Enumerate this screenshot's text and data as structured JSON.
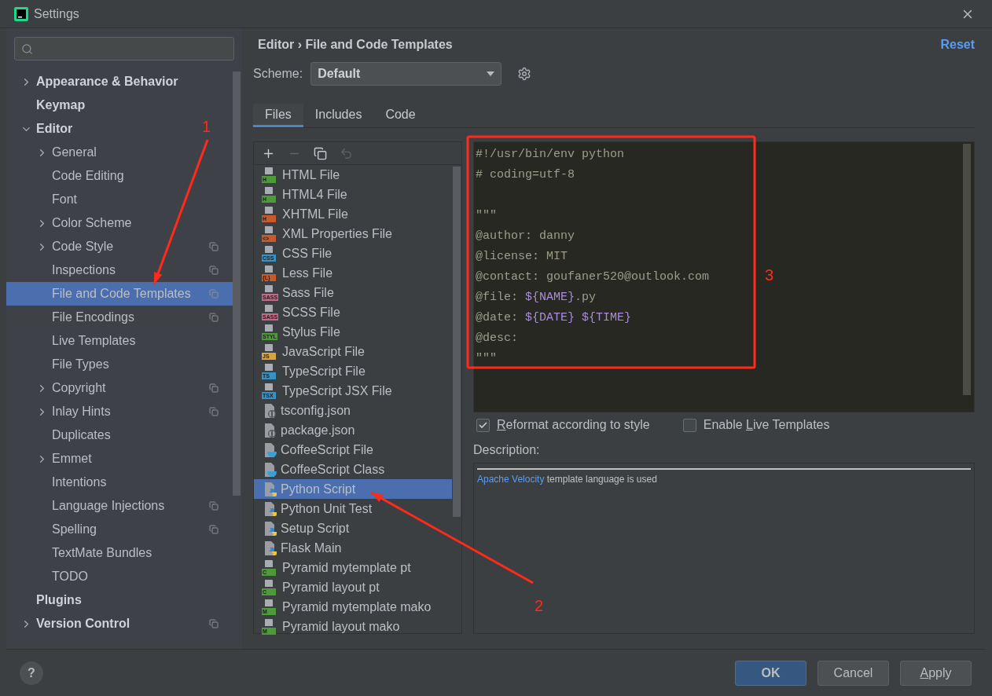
{
  "window": {
    "title": "Settings"
  },
  "tree": [
    {
      "label": "Appearance & Behavior",
      "expanded": false,
      "scoped": false,
      "selected": false
    },
    {
      "label": "Keymap",
      "scoped": false,
      "selected": false
    },
    {
      "label": "Editor",
      "expanded": true,
      "scoped": false,
      "selected": false,
      "children": [
        {
          "label": "General",
          "expanded": false,
          "scoped": false,
          "selected": false
        },
        {
          "label": "Code Editing",
          "scoped": false,
          "selected": false
        },
        {
          "label": "Font",
          "scoped": false,
          "selected": false
        },
        {
          "label": "Color Scheme",
          "expanded": false,
          "scoped": false,
          "selected": false
        },
        {
          "label": "Code Style",
          "expanded": false,
          "scoped": true,
          "selected": false
        },
        {
          "label": "Inspections",
          "scoped": true,
          "selected": false
        },
        {
          "label": "File and Code Templates",
          "scoped": true,
          "selected": true
        },
        {
          "label": "File Encodings",
          "scoped": true,
          "selected": false
        },
        {
          "label": "Live Templates",
          "scoped": false,
          "selected": false
        },
        {
          "label": "File Types",
          "scoped": false,
          "selected": false
        },
        {
          "label": "Copyright",
          "expanded": false,
          "scoped": true,
          "selected": false
        },
        {
          "label": "Inlay Hints",
          "expanded": false,
          "scoped": true,
          "selected": false
        },
        {
          "label": "Duplicates",
          "scoped": false,
          "selected": false
        },
        {
          "label": "Emmet",
          "expanded": false,
          "scoped": false,
          "selected": false
        },
        {
          "label": "Intentions",
          "scoped": false,
          "selected": false
        },
        {
          "label": "Language Injections",
          "scoped": true,
          "selected": false
        },
        {
          "label": "Spelling",
          "scoped": true,
          "selected": false
        },
        {
          "label": "TextMate Bundles",
          "scoped": false,
          "selected": false
        },
        {
          "label": "TODO",
          "scoped": false,
          "selected": false
        }
      ]
    },
    {
      "label": "Plugins",
      "scoped": false,
      "selected": false
    },
    {
      "label": "Version Control",
      "expanded": false,
      "scoped": true,
      "selected": false
    }
  ],
  "breadcrumb": [
    "Editor",
    "›",
    "File and Code Templates"
  ],
  "reset": "Reset",
  "scheme": {
    "label": "Scheme:",
    "value": "Default"
  },
  "tabs": [
    {
      "label": "Files",
      "selected": true
    },
    {
      "label": "Includes",
      "selected": false
    },
    {
      "label": "Code",
      "selected": false
    }
  ],
  "toolbar": [
    {
      "kind": "add",
      "disabled": false
    },
    {
      "kind": "remove",
      "disabled": true
    },
    {
      "kind": "copy",
      "disabled": false
    },
    {
      "kind": "reset",
      "disabled": true
    }
  ],
  "templates": [
    {
      "label": "HTML File",
      "kind": "badge",
      "badge": "H",
      "color": "#4e9a3a",
      "selected": false
    },
    {
      "label": "HTML4 File",
      "kind": "badge",
      "badge": "H",
      "color": "#4e9a3a",
      "selected": false
    },
    {
      "label": "XHTML File",
      "kind": "badge",
      "badge": "H",
      "color": "#c75a2a",
      "selected": false
    },
    {
      "label": "XML Properties File",
      "kind": "badge",
      "badge": "<>",
      "color": "#c75a2a",
      "selected": false
    },
    {
      "label": "CSS File",
      "kind": "badge",
      "badge": "CSS",
      "color": "#3592c4",
      "selected": false
    },
    {
      "label": "Less File",
      "kind": "badge",
      "badge": "{L}",
      "color": "#c75a2a",
      "selected": false
    },
    {
      "label": "Sass File",
      "kind": "badge",
      "badge": "SASS",
      "color": "#c46a86",
      "selected": false
    },
    {
      "label": "SCSS File",
      "kind": "badge",
      "badge": "SASS",
      "color": "#c46a86",
      "selected": false
    },
    {
      "label": "Stylus File",
      "kind": "badge",
      "badge": "STYL",
      "color": "#4e9a3a",
      "selected": false
    },
    {
      "label": "JavaScript File",
      "kind": "badge",
      "badge": "JS",
      "color": "#d9a343",
      "selected": false
    },
    {
      "label": "TypeScript File",
      "kind": "badge",
      "badge": "TS",
      "color": "#3592c4",
      "selected": false
    },
    {
      "label": "TypeScript JSX File",
      "kind": "badge",
      "badge": "TSX",
      "color": "#3592c4",
      "selected": false
    },
    {
      "label": "tsconfig.json",
      "kind": "json",
      "selected": false
    },
    {
      "label": "package.json",
      "kind": "json",
      "selected": false
    },
    {
      "label": "CoffeeScript File",
      "kind": "coffee",
      "selected": false
    },
    {
      "label": "CoffeeScript Class",
      "kind": "coffee",
      "selected": false
    },
    {
      "label": "Python Script",
      "kind": "python",
      "selected": true
    },
    {
      "label": "Python Unit Test",
      "kind": "python",
      "selected": false
    },
    {
      "label": "Setup Script",
      "kind": "python",
      "selected": false
    },
    {
      "label": "Flask Main",
      "kind": "python",
      "selected": false
    },
    {
      "label": "Pyramid mytemplate pt",
      "kind": "badge",
      "badge": "C",
      "color": "#4e9a3a",
      "selected": false
    },
    {
      "label": "Pyramid layout pt",
      "kind": "badge",
      "badge": "C",
      "color": "#4e9a3a",
      "selected": false
    },
    {
      "label": "Pyramid mytemplate mako",
      "kind": "badge",
      "badge": "M",
      "color": "#4e9a3a",
      "selected": false
    },
    {
      "label": "Pyramid layout mako",
      "kind": "badge",
      "badge": "M",
      "color": "#4e9a3a",
      "selected": false
    }
  ],
  "code": [
    {
      "kind": "line",
      "segments": [
        {
          "kind": "text",
          "text": "#!/usr/bin/env python"
        }
      ]
    },
    {
      "kind": "line",
      "segments": [
        {
          "kind": "text",
          "text": "# coding=utf-8"
        }
      ]
    },
    {
      "kind": "blank"
    },
    {
      "kind": "line",
      "segments": [
        {
          "kind": "text",
          "text": "\"\"\""
        }
      ]
    },
    {
      "kind": "line",
      "segments": [
        {
          "kind": "text",
          "text": "@author: danny"
        }
      ]
    },
    {
      "kind": "line",
      "segments": [
        {
          "kind": "text",
          "text": "@license: MIT"
        }
      ]
    },
    {
      "kind": "line",
      "segments": [
        {
          "kind": "text",
          "text": "@contact: goufaner520@outlook.com"
        }
      ]
    },
    {
      "kind": "line",
      "segments": [
        {
          "kind": "text",
          "text": "@file: "
        },
        {
          "kind": "variable",
          "text": "${NAME}"
        },
        {
          "kind": "text",
          "text": ".py"
        }
      ]
    },
    {
      "kind": "line",
      "segments": [
        {
          "kind": "text",
          "text": "@date: "
        },
        {
          "kind": "variable",
          "text": "${DATE} ${TIME}"
        }
      ]
    },
    {
      "kind": "line",
      "segments": [
        {
          "kind": "text",
          "text": "@desc:"
        }
      ]
    },
    {
      "kind": "line",
      "segments": [
        {
          "kind": "text",
          "text": "\"\"\""
        }
      ]
    }
  ],
  "options": [
    {
      "key": "R",
      "post": "eformat according to style",
      "checked": true
    },
    {
      "pre": "Enable ",
      "key": "L",
      "post": "ive Templates",
      "checked": false
    }
  ],
  "description": {
    "label": "Description:",
    "link": "Apache Velocity",
    "text": " template language is used"
  },
  "help": "?",
  "buttons": [
    {
      "post": "OK",
      "default": true
    },
    {
      "post": "Cancel",
      "default": false
    },
    {
      "key": "A",
      "post": "pply",
      "default": false
    }
  ],
  "annotations": [
    {
      "kind": "arrow",
      "label": "1"
    },
    {
      "kind": "arrow",
      "label": "2"
    },
    {
      "kind": "box",
      "label": "3"
    }
  ]
}
